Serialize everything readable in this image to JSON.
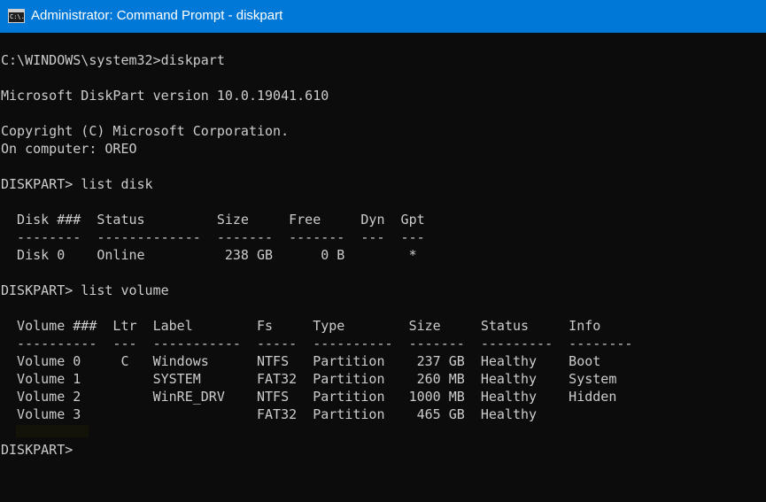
{
  "titlebar": {
    "title": "Administrator: Command Prompt - diskpart",
    "icon": "command-prompt-icon",
    "icon_text": "C:\\."
  },
  "colors": {
    "titlebar_bg": "#0078d7",
    "console_bg": "#0c0c0c",
    "console_text": "#cccccc"
  },
  "console": {
    "lines": [
      "C:\\WINDOWS\\system32>diskpart",
      "",
      "Microsoft DiskPart version 10.0.19041.610",
      "",
      "Copyright (C) Microsoft Corporation.",
      "On computer: OREO",
      "",
      "DISKPART> list disk",
      "",
      "  Disk ###  Status         Size     Free     Dyn  Gpt",
      "  --------  -------------  -------  -------  ---  ---",
      "  Disk 0    Online          238 GB      0 B        *",
      "",
      "DISKPART> list volume",
      "",
      "  Volume ###  Ltr  Label        Fs     Type        Size     Status     Info",
      "  ----------  ---  -----------  -----  ----------  -------  ---------  --------",
      "  Volume 0     C   Windows      NTFS   Partition    237 GB  Healthy    Boot",
      "  Volume 1         SYSTEM       FAT32  Partition    260 MB  Healthy    System",
      "  Volume 2         WinRE_DRV    NTFS   Partition   1000 MB  Healthy    Hidden",
      "  Volume 3                      FAT32  Partition    465 GB  Healthy",
      "",
      "DISKPART>"
    ]
  }
}
